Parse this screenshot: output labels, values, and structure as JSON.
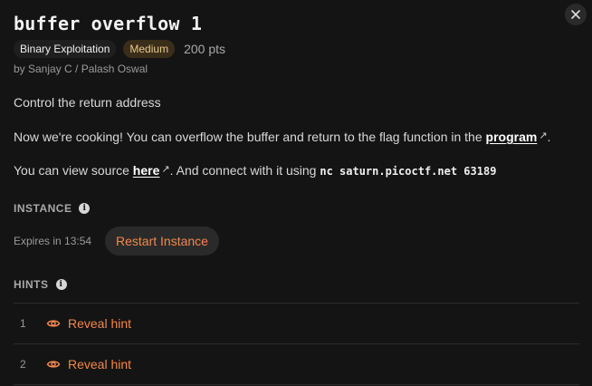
{
  "challenge": {
    "title": "buffer overflow 1",
    "category": "Binary Exploitation",
    "difficulty": "Medium",
    "points": "200 pts",
    "author": "by Sanjay C / Palash Oswal",
    "subtitle": "Control the return address",
    "description_prefix": "Now we're cooking! You can overflow the buffer and return to the flag function in the ",
    "description_link": "program",
    "description_suffix": ".",
    "source_prefix": "You can view source ",
    "source_link": "here",
    "source_middle": ". And connect with it using ",
    "connect_command": "nc saturn.picoctf.net 63189"
  },
  "instance": {
    "label": "INSTANCE",
    "expires": "Expires in 13:54",
    "restart_label": "Restart Instance"
  },
  "hints": {
    "label": "HINTS",
    "items": [
      {
        "number": "1",
        "action": "Reveal hint"
      },
      {
        "number": "2",
        "action": "Reveal hint"
      }
    ]
  },
  "colors": {
    "accent": "#f2884c",
    "background": "#141414",
    "difficulty_bg": "#3a2e1a",
    "difficulty_text": "#e9c78a"
  },
  "icons": {
    "close": "close-icon",
    "info": "info-icon",
    "external": "external-link-icon",
    "eye": "eye-icon"
  }
}
